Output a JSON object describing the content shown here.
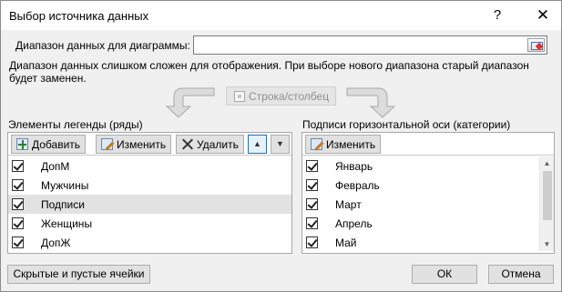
{
  "window": {
    "title": "Выбор источника данных",
    "help": "?",
    "close": "✕"
  },
  "range": {
    "label": "Диапазон данных для диаграммы:",
    "value": "",
    "picker_icon": "range-picker-icon"
  },
  "message": "Диапазон данных слишком сложен для отображения. При выборе нового диапазона старый диапазон будет заменен.",
  "switch_button": "Строка/столбец",
  "legend": {
    "label": "Элементы легенды (ряды)",
    "add": "Добавить",
    "edit": "Изменить",
    "delete": "Удалить",
    "up": "▲",
    "down": "▼",
    "items": [
      {
        "label": "ДопМ",
        "checked": true
      },
      {
        "label": "Мужчины",
        "checked": true
      },
      {
        "label": "Подписи",
        "checked": true
      },
      {
        "label": "Женщины",
        "checked": true
      },
      {
        "label": "ДопЖ",
        "checked": true
      }
    ],
    "selected_index": 2
  },
  "axis": {
    "label": "Подписи горизонтальной оси (категории)",
    "edit": "Изменить",
    "scroll_up": "▲",
    "scroll_down": "▼",
    "items": [
      {
        "label": "Январь",
        "checked": true
      },
      {
        "label": "Февраль",
        "checked": true
      },
      {
        "label": "Март",
        "checked": true
      },
      {
        "label": "Апрель",
        "checked": true
      },
      {
        "label": "Май",
        "checked": true
      }
    ]
  },
  "footer": {
    "hidden_cells": "Скрытые и пустые ячейки",
    "ok": "ОК",
    "cancel": "Отмена"
  },
  "colors": {
    "accent": "#0078d7",
    "selection": "#e2e2e2",
    "dialog_bg": "#f0f0f0"
  }
}
